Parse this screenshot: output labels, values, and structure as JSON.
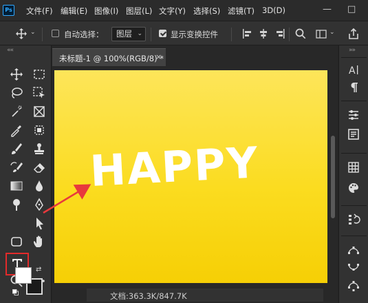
{
  "app": {
    "logo": "Ps"
  },
  "menubar": {
    "items": [
      "文件(F)",
      "编辑(E)",
      "图像(I)",
      "图层(L)",
      "文字(Y)",
      "选择(S)",
      "滤镜(T)",
      "3D(D)"
    ],
    "window_buttons": [
      "—",
      "□"
    ]
  },
  "optionsbar": {
    "auto_select_label": "自动选择：",
    "auto_select_checked": false,
    "auto_select_target": "图层",
    "show_transform_label": "显示变换控件",
    "show_transform_checked": true
  },
  "document": {
    "tab_title": "未标题-1 @ 100%(RGB/8) *",
    "close_glyph": "×",
    "canvas_text": "HAPPY",
    "status": "文档:363.3K/847.7K",
    "canvas_color_top": "#fde55a",
    "canvas_color_bottom": "#f6cf05"
  },
  "toolbar": {
    "active_tool": "type-tool",
    "highlight_color": "#e32b2b"
  },
  "annotation": {
    "arrow_color": "#e8393c"
  }
}
